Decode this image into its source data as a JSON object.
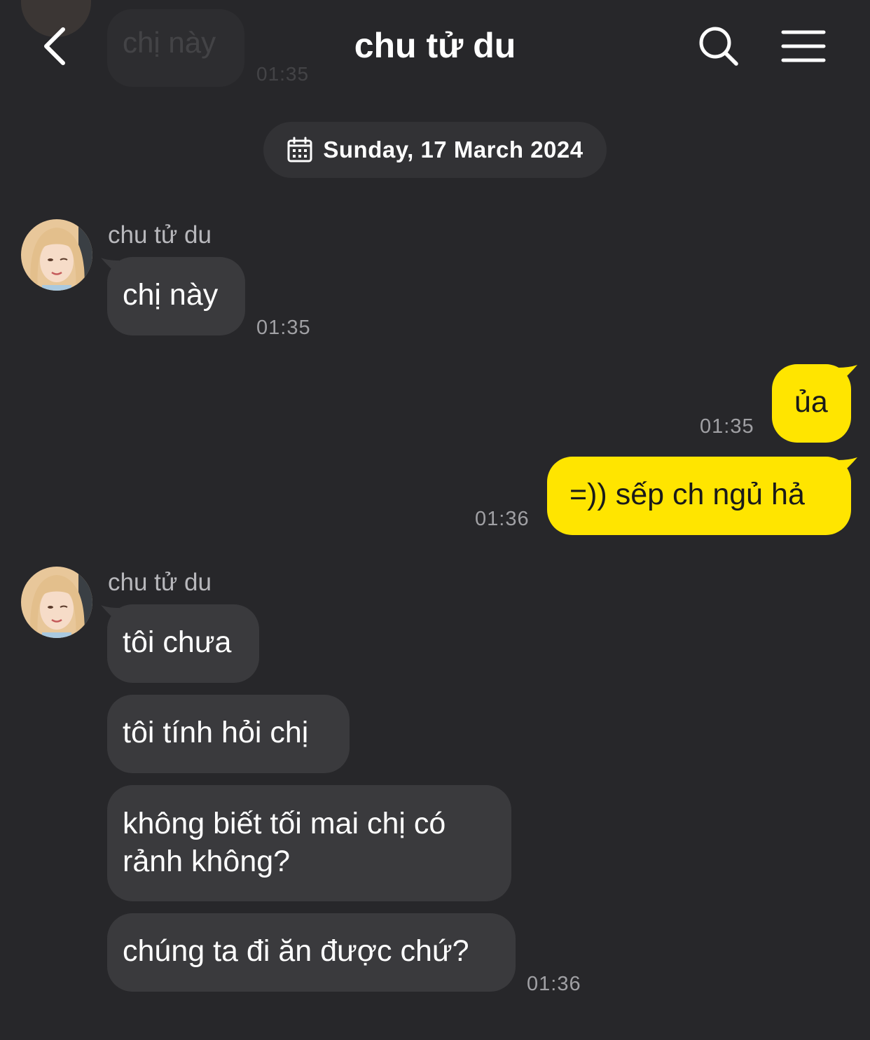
{
  "header": {
    "title": "chu tử du"
  },
  "ghost": {
    "text": "chị này",
    "time": "01:35"
  },
  "date_divider": {
    "label": "Sunday, 17 March 2024"
  },
  "colors": {
    "background": "#27272a",
    "incoming_bubble": "#3a3a3d",
    "outgoing_bubble": "#ffe500",
    "date_pill": "#323235"
  },
  "messages": {
    "group1": {
      "sender": "chu tử du",
      "m1": {
        "text": "chị này",
        "time": "01:35"
      }
    },
    "outgoing": {
      "m1": {
        "text": "ủa",
        "time": "01:35"
      },
      "m2": {
        "text": "=)) sếp ch ngủ hả",
        "time": "01:36"
      }
    },
    "group2": {
      "sender": "chu tử du",
      "m1": {
        "text": "tôi chưa"
      },
      "m2": {
        "text": "tôi tính hỏi chị"
      },
      "m3": {
        "text": "không biết tối mai chị có rảnh không?"
      },
      "m4": {
        "text": "chúng ta đi ăn được chứ?",
        "time": "01:36"
      }
    }
  }
}
